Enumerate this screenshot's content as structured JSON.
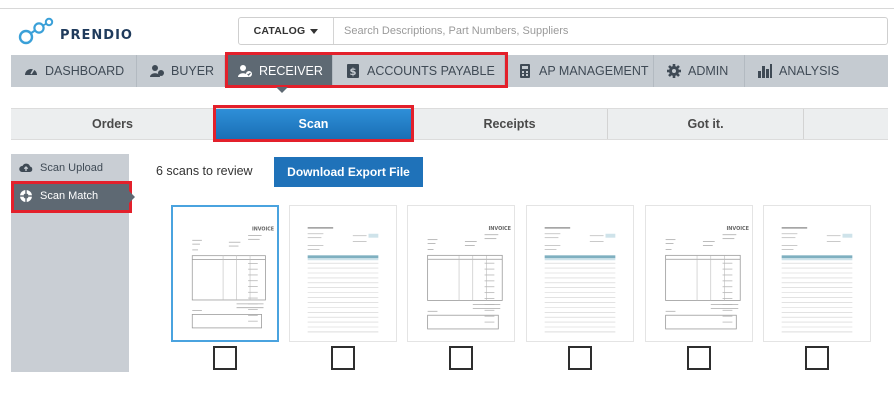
{
  "header": {
    "logo_text": "PRENDIO",
    "catalog_label": "CATALOG",
    "search_placeholder": "Search Descriptions, Part Numbers, Suppliers"
  },
  "main_nav": {
    "items": [
      {
        "label": "DASHBOARD",
        "icon": "dashboard-gauge-icon"
      },
      {
        "label": "BUYER",
        "icon": "buyer-users-icon"
      },
      {
        "label": "RECEIVER",
        "icon": "receiver-user-icon"
      },
      {
        "label": "ACCOUNTS PAYABLE",
        "icon": "accounts-payable-dollar-icon"
      },
      {
        "label": "AP MANAGEMENT",
        "icon": "calculator-icon"
      },
      {
        "label": "ADMIN",
        "icon": "gear-icon"
      },
      {
        "label": "ANALYSIS",
        "icon": "bar-chart-icon"
      }
    ],
    "active": "RECEIVER"
  },
  "sub_tabs": {
    "items": [
      "Orders",
      "Scan",
      "Receipts",
      "Got it."
    ],
    "active": "Scan"
  },
  "sidebar": {
    "items": [
      {
        "label": "Scan Upload",
        "icon": "cloud-upload-icon"
      },
      {
        "label": "Scan Match",
        "icon": "lifebuoy-icon"
      }
    ],
    "active": "Scan Match"
  },
  "content": {
    "scan_count_text": "6 scans to review",
    "export_button_label": "Download Export File",
    "thumbnails": [
      {
        "kind": "invoice",
        "selected": true,
        "checked": false
      },
      {
        "kind": "packing",
        "selected": false,
        "checked": false
      },
      {
        "kind": "invoice",
        "selected": false,
        "checked": false
      },
      {
        "kind": "packing",
        "selected": false,
        "checked": false
      },
      {
        "kind": "invoice",
        "selected": false,
        "checked": false
      },
      {
        "kind": "packing",
        "selected": false,
        "checked": false
      }
    ]
  },
  "colors": {
    "accent_blue": "#1f72b9",
    "nav_bg": "#c5cbd1",
    "nav_active": "#5e6973",
    "highlight_red": "#e3202b"
  }
}
